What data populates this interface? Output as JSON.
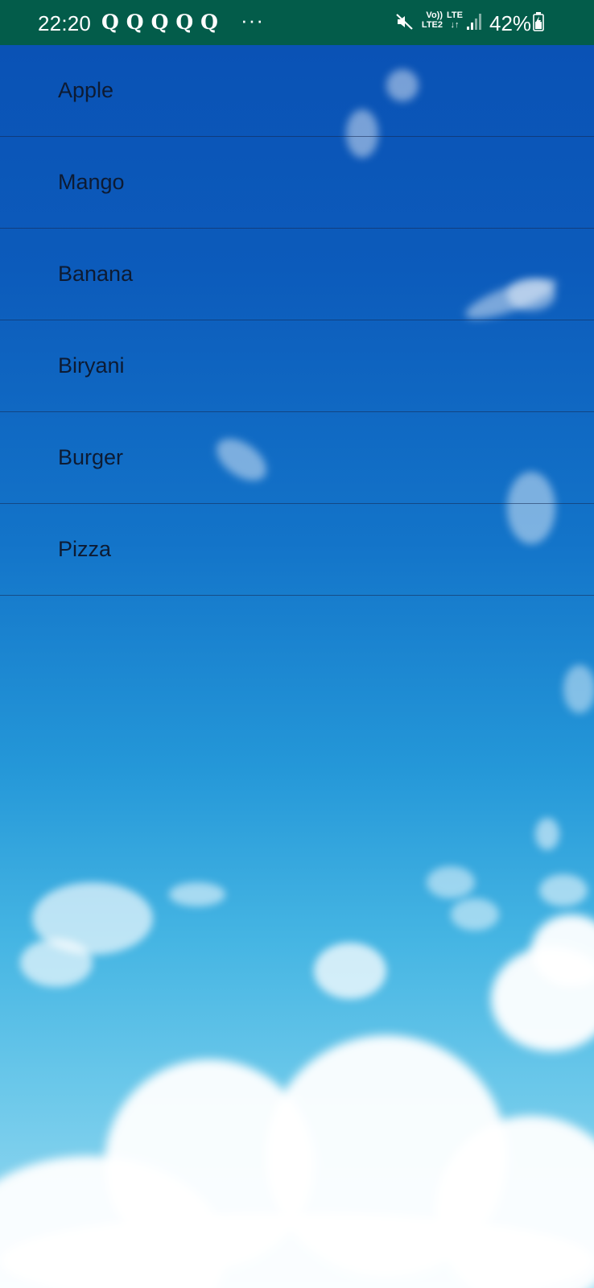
{
  "status_bar": {
    "time": "22:20",
    "notifications": [
      "Q",
      "Q",
      "Q",
      "Q",
      "Q"
    ],
    "more_indicator": "···",
    "volte_label_top": "Vo))",
    "volte_label_bottom": "LTE2",
    "lte_label_top": "LTE",
    "lte_label_bottom": "↓↑",
    "battery_percent": "42%",
    "icons": [
      "mute-icon",
      "volte-icon",
      "lte-icon",
      "signal-icon",
      "battery-icon"
    ],
    "background_color": "#035c4a"
  },
  "list": {
    "items": [
      {
        "label": "Apple"
      },
      {
        "label": "Mango"
      },
      {
        "label": "Banana"
      },
      {
        "label": "Biryani"
      },
      {
        "label": "Burger"
      },
      {
        "label": "Pizza"
      }
    ]
  },
  "background": {
    "description_colors": [
      "#0a52b5",
      "#1374c9",
      "#45b5e3",
      "#9fdcf2"
    ]
  }
}
